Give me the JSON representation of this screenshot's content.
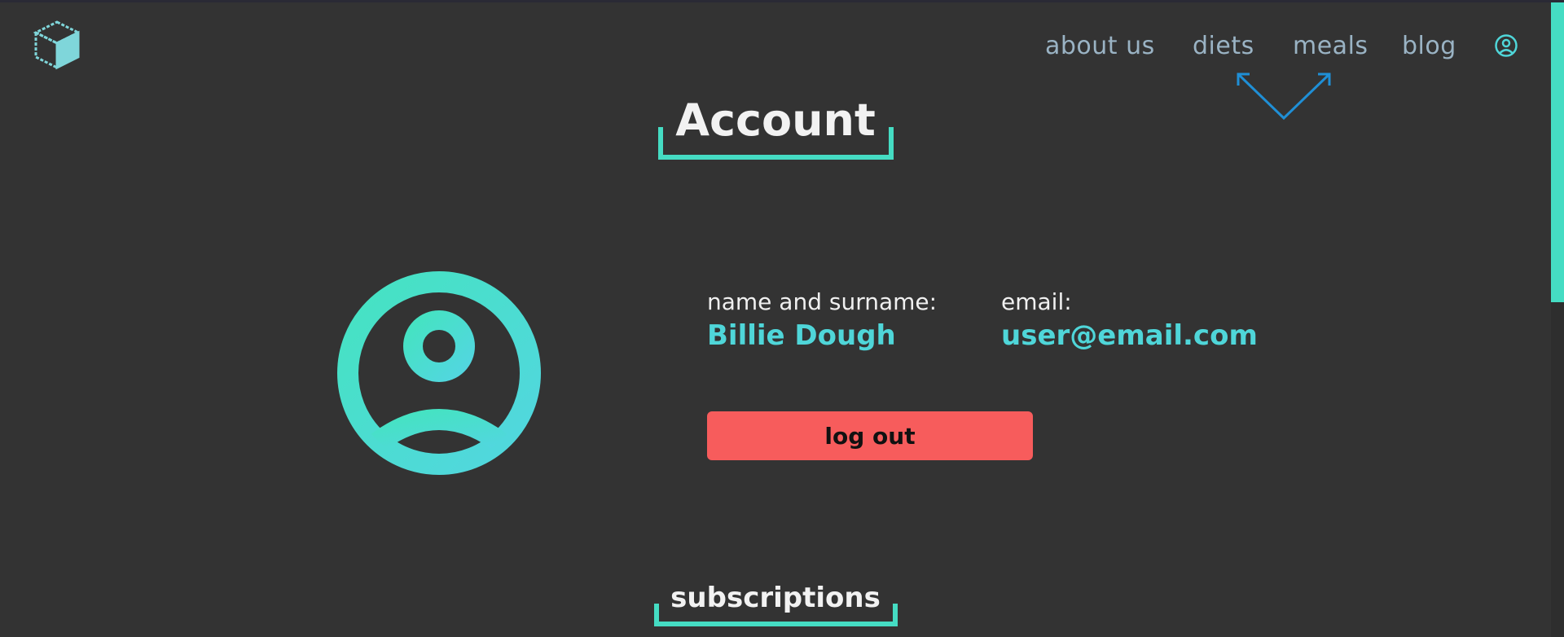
{
  "header": {
    "logo_icon": "cube-logo-icon",
    "nav": {
      "about": "about us",
      "diets": "diets",
      "meals": "meals",
      "blog": "blog"
    },
    "user_icon": "user-circle-icon"
  },
  "account": {
    "title": "Account",
    "avatar_icon": "user-avatar-icon",
    "name_label": "name and surname:",
    "name_value": "Billie Dough",
    "email_label": "email:",
    "email_value": "user@email.com",
    "logout_label": "log out"
  },
  "subscriptions": {
    "title": "subscriptions"
  },
  "colors": {
    "background": "#333333",
    "accent": "#45dcc3",
    "accent_text": "#4fd6d9",
    "nav_text": "#9ab3c4",
    "logout_button": "#f75c5c",
    "arrow": "#1f8fd6"
  }
}
